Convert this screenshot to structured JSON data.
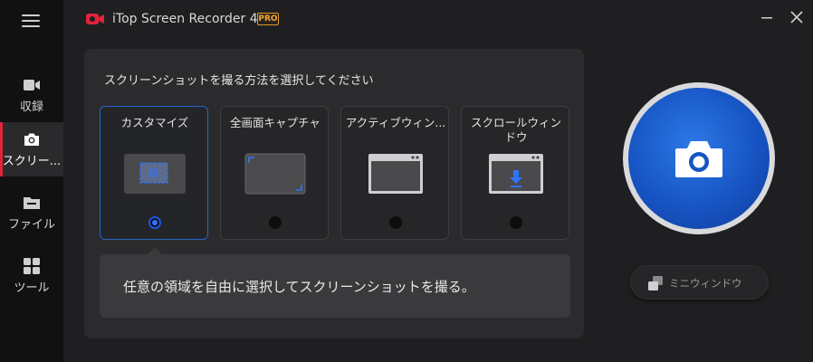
{
  "app": {
    "title": "iTop Screen Recorder 4.0",
    "badge": "PRO",
    "accent_color": "#e0243a",
    "primary_blue": "#1f57d8"
  },
  "sidebar": {
    "menu_icon": "hamburger-menu-icon",
    "items": [
      {
        "label": "収録",
        "icon": "video-camera-icon",
        "active": false
      },
      {
        "label": "スクリー...",
        "icon": "camera-icon",
        "active": true
      },
      {
        "label": "ファイル",
        "icon": "folder-icon",
        "active": false
      },
      {
        "label": "ツール",
        "icon": "grid-tools-icon",
        "active": false
      }
    ]
  },
  "window_controls": {
    "minimize_icon": "minimize-icon",
    "close_icon": "close-icon"
  },
  "panel": {
    "title": "スクリーンショットを撮る方法を選択してください",
    "options": [
      {
        "label": "カスタマイズ",
        "icon": "custom-region-icon",
        "selected": true
      },
      {
        "label": "全画面キャプチャ",
        "icon": "fullscreen-capture-icon",
        "selected": false
      },
      {
        "label": "アクティブウィン...",
        "icon": "active-window-icon",
        "selected": false
      },
      {
        "label": "スクロールウィンドウ",
        "icon": "scroll-window-icon",
        "selected": false
      }
    ],
    "description": "任意の領域を自由に選択してスクリーンショットを撮る。"
  },
  "capture": {
    "icon": "camera-shutter-icon"
  },
  "mini_window": {
    "label": "ミニウィンドウ",
    "icon": "mini-window-icon"
  }
}
